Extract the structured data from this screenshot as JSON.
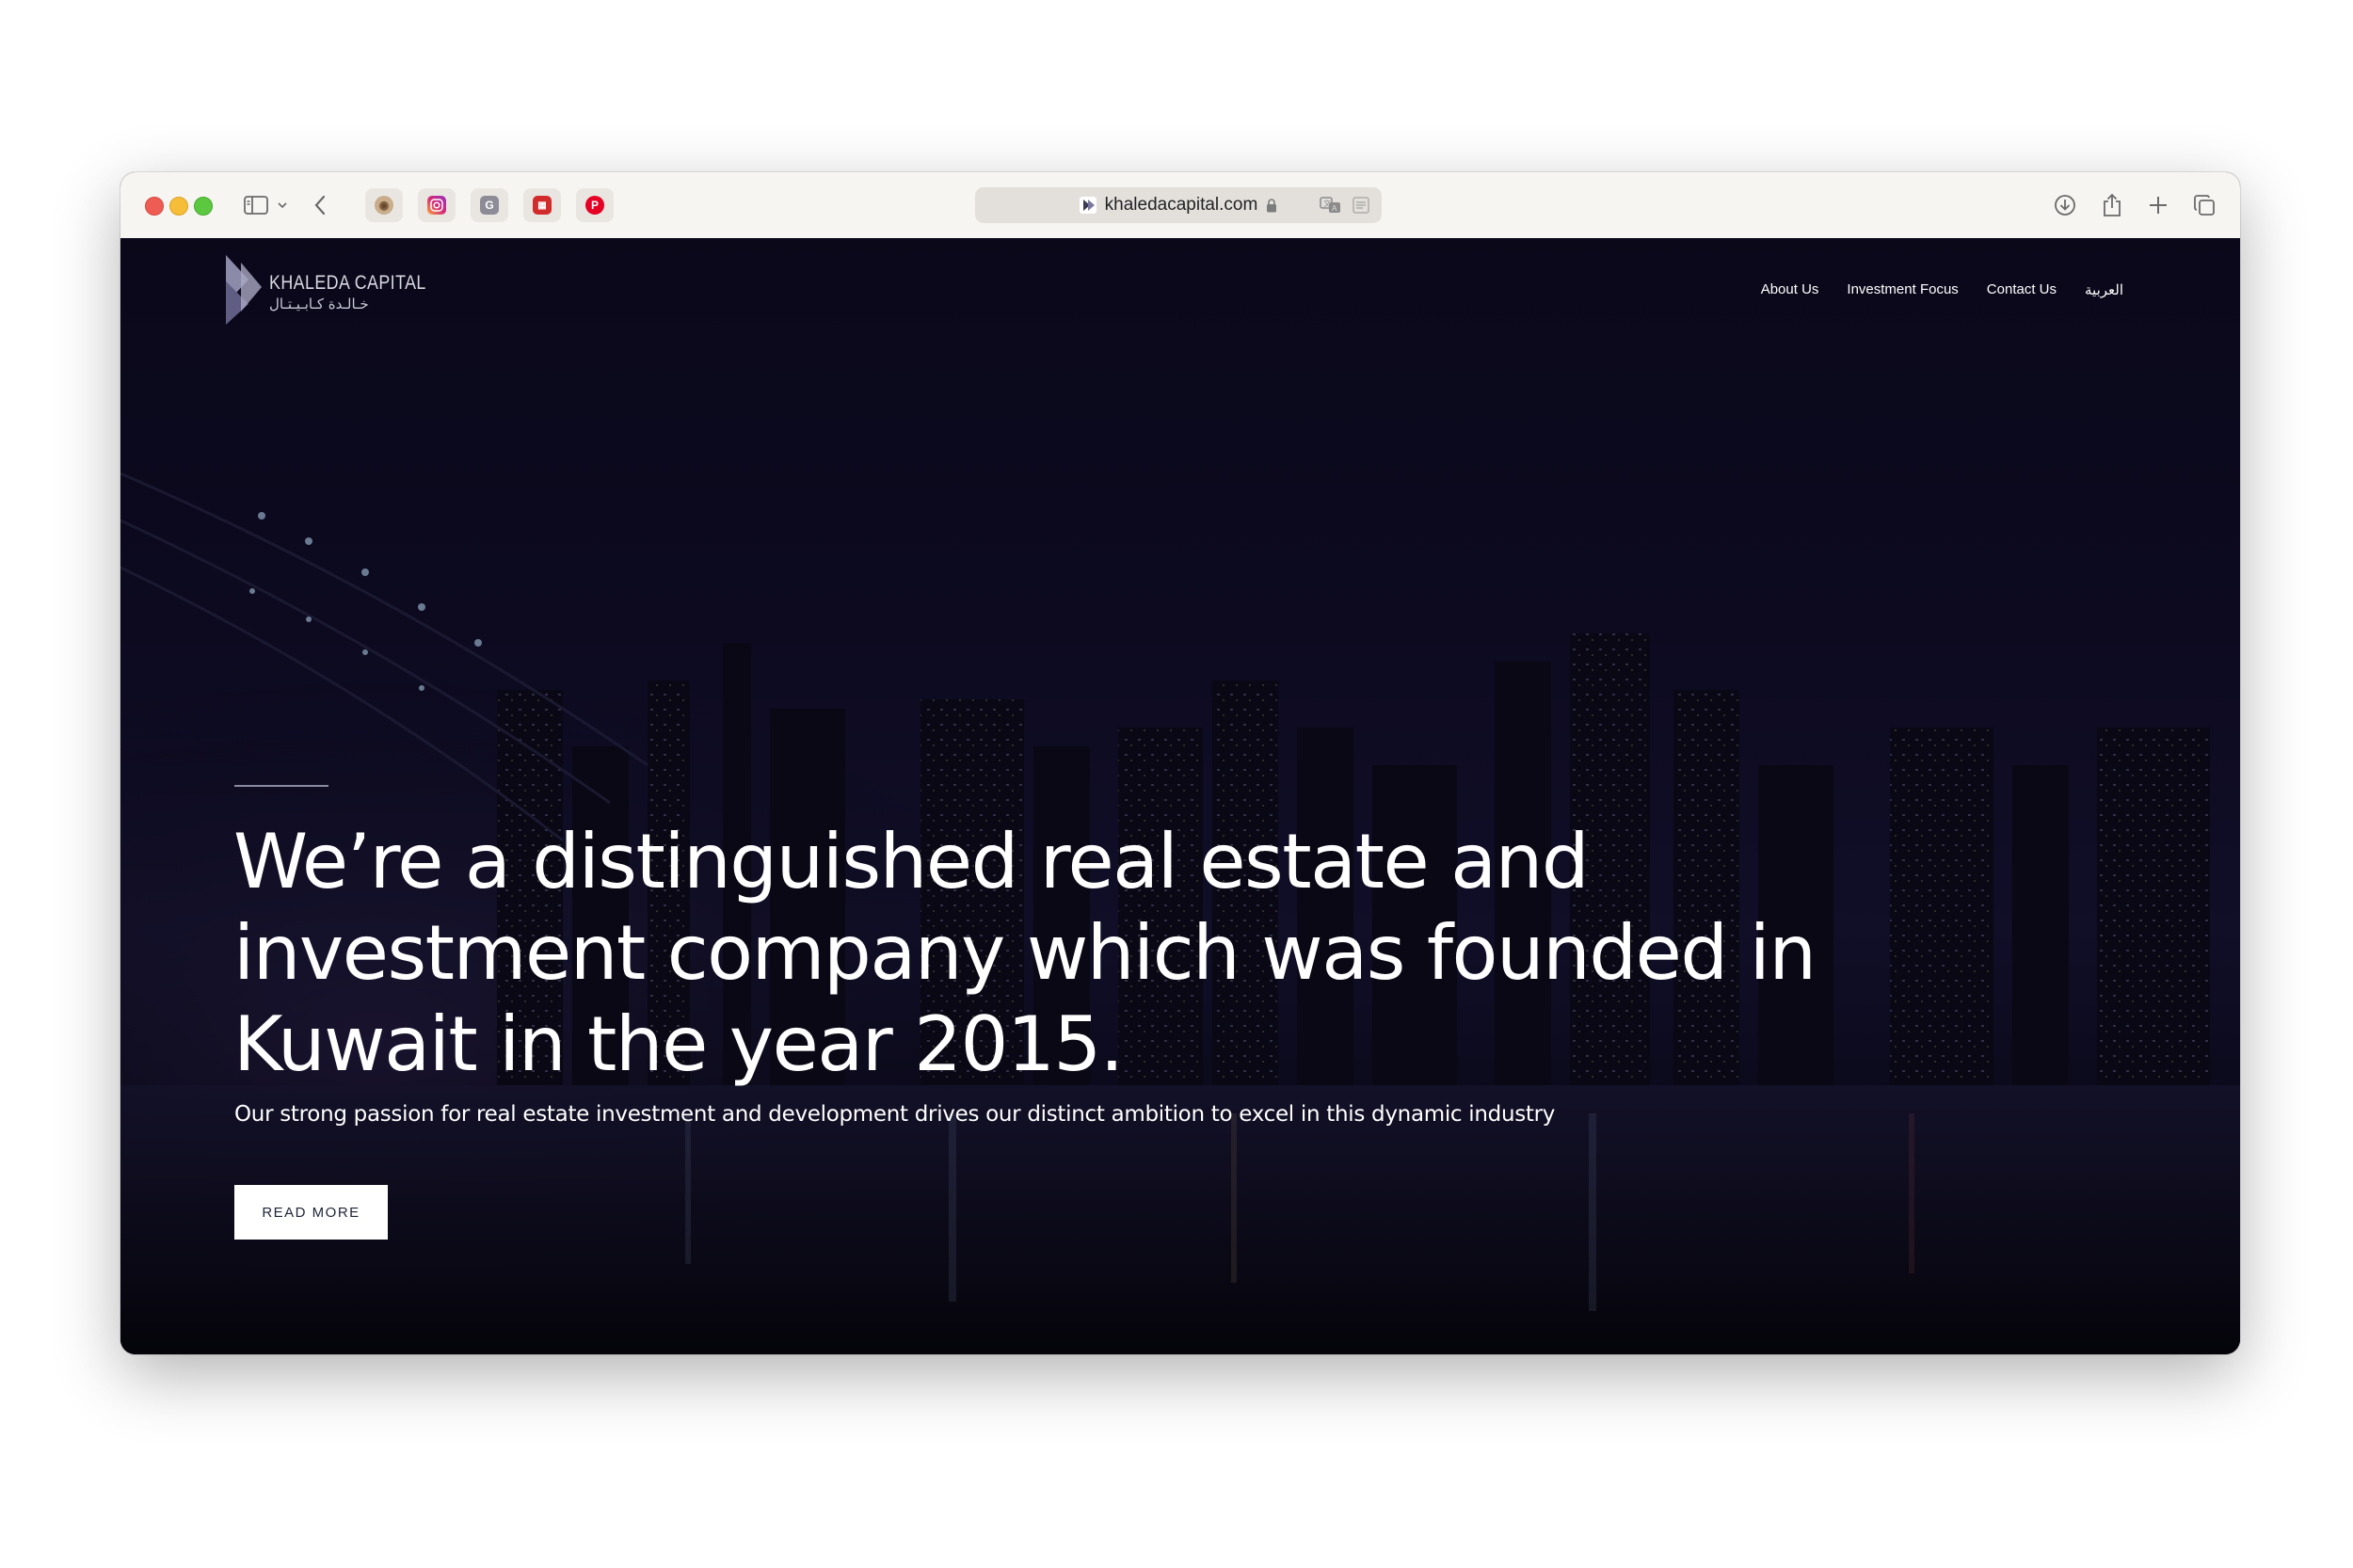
{
  "browser": {
    "url": "khaledacapital.com",
    "favorites": [
      {
        "icon": "monkey-icon",
        "bg": "#c9ad8a"
      },
      {
        "icon": "instagram-icon",
        "bg": "#d62976"
      },
      {
        "icon": "g-icon",
        "bg": "#8c8c96"
      },
      {
        "icon": "stamp-icon",
        "bg": "#d22b2b"
      },
      {
        "icon": "pinterest-icon",
        "bg": "#e60023"
      }
    ]
  },
  "site": {
    "logo": {
      "en": "KHALEDA CAPITAL",
      "ar": "خـالـدة كـابـيـتـال"
    },
    "nav": {
      "about": "About Us",
      "investment": "Investment Focus",
      "contact": "Contact Us",
      "arabic": "العربية"
    },
    "hero": {
      "title": "We’re a distinguished real estate and investment company which was founded in Kuwait in the year 2015.",
      "subtitle": "Our strong passion for real estate investment and development drives our distinct ambition to excel in this dynamic industry",
      "button": "READ MORE"
    }
  },
  "colors": {
    "hero_bg": "#0c0a1d",
    "accent": "#6f6d9a",
    "button_text": "#1e2437"
  }
}
